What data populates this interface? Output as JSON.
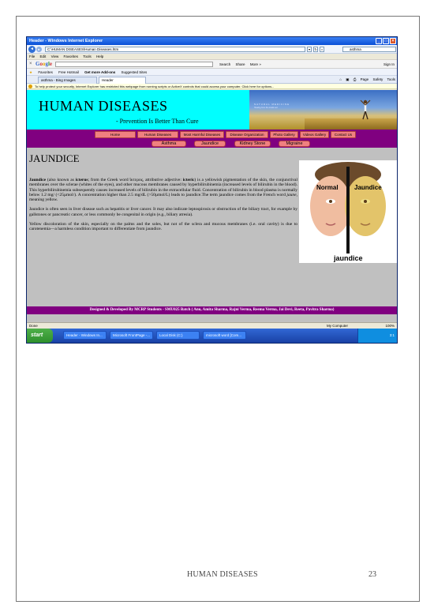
{
  "browser": {
    "title": "Header - Windows Internet Explorer",
    "url": "C:\\HUMAN DISEASES\\Human Diseases.htm",
    "search_value": "asthma",
    "menu": [
      "File",
      "Edit",
      "View",
      "Favorites",
      "Tools",
      "Help"
    ],
    "google_toolbar": {
      "logo": "Google",
      "items": [
        "Search",
        "Share",
        "More »"
      ],
      "signin": "Sign In"
    },
    "favorites": [
      "Favorites",
      "Free Hotmail",
      "Get more Add-ons",
      "Suggested Sites"
    ],
    "tabs": [
      "asthma - Bing Images",
      "Header"
    ],
    "tab_tools": [
      "Page",
      "Safety",
      "Tools"
    ],
    "infobar": "To help protect your security, Internet Explorer has restricted this webpage from running scripts or ActiveX controls that could access your computer. Click here for options...",
    "status": {
      "left": "Done",
      "zone": "My Computer",
      "zoom": "100%"
    }
  },
  "taskbar": {
    "start": "start",
    "tasks": [
      "Header - Windows In...",
      "Microsoft FrontPage -...",
      "Local Disk (C:)",
      "microsoft word [Com..."
    ],
    "clock": "3:1"
  },
  "site": {
    "title": "HUMAN DISEASES",
    "tagline": "- Prevention Is Better Than Cure",
    "banner_text": "NATURAL MEDICINE",
    "banner_subtext": "Healing from the inside out",
    "nav_primary": [
      "Home",
      "Human Diseases",
      "Most Harmful Diseases",
      "Disease Organization",
      "Photo Gallery",
      "Videos Gallery",
      "Contact Us"
    ],
    "nav_secondary": [
      "Asthma",
      "Jaundice",
      "Kidney Stone",
      "Migraine"
    ],
    "heading": "JAUNDICE",
    "para1": {
      "term": "Jaundice",
      "t1": " (also known as ",
      "term2": "icterus",
      "t2": "; from the Greek word ἴκτερος, attributive adjective: ",
      "term3": "icteric",
      "t3": ") is a yellowish pigmentation of the skin, the conjunctival membranes over the sclerae (whites of the eyes), and other mucous membranes caused by hyperbilirubinemia (increased levels of bilirubin in the blood). This hyperbilirubinemia subsequently causes increased levels of bilirubin in the extracellular fluid. Concentration of bilirubin in blood plasma is normally below 1.2 mg/ (<25µmol/). A concentration higher than 2.5 mg/dL (>50µmol/L) leads to jaundice.The term jaundice comes from the French word ",
      "term4": "jaune",
      "t4": ", meaning yellow."
    },
    "para2": "Jaundice is often seen in liver disease such as hepatitis or liver cancer. It may also indicate leptospirosis or obstruction of the biliary tract, for example by gallstones or pancreatic cancer, or less commonly be congenital in origin (e.g., biliary atresia).",
    "para3": "Yellow discoloration of the skin, especially on the palms and the soles, but not of the sclera and mucous membranes (i.e. oral cavity) is due to carotenemia—a harmless condition important to differentiate from jaundice.",
    "image_labels": {
      "left": "Normal",
      "right": "Jaundice",
      "bottom": "jaundice"
    },
    "footer": "Designed & Developed By MCRP Students - SMU025 Batch ( Anu, Amita Sharma, Rajni Verma, Reema Verma, Jai Devi, Reeta, Pavitra Sharma)"
  },
  "page": {
    "footer_title": "HUMAN DISEASES",
    "page_number": "23"
  }
}
